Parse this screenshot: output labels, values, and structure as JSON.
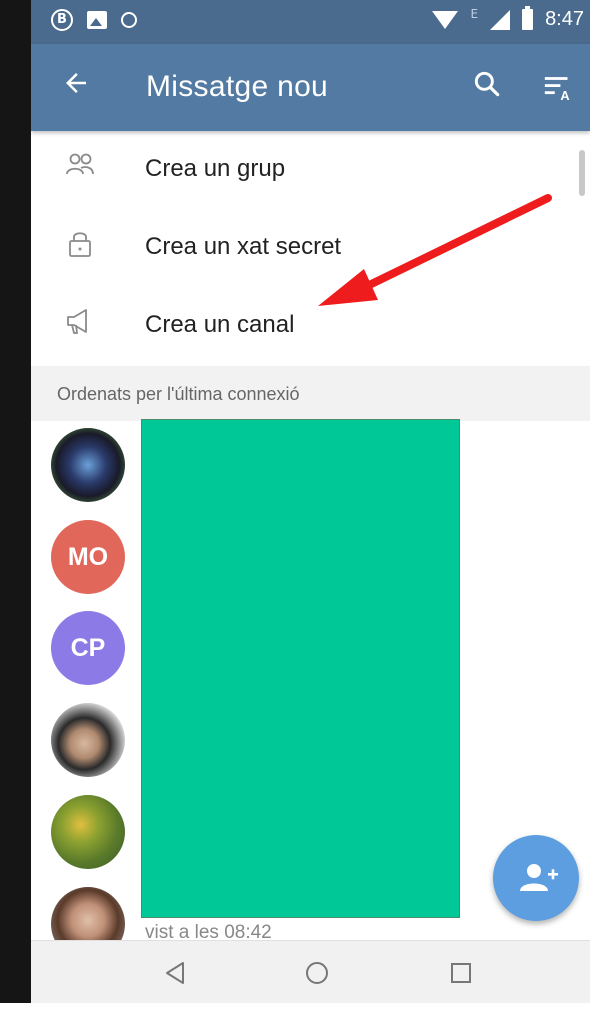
{
  "status_bar": {
    "time": "8:47",
    "network_letter": "E",
    "left_icons": [
      "b-circle-icon",
      "image-icon",
      "sync-icon"
    ],
    "right_icons": [
      "wifi-icon",
      "signal-icon",
      "battery-icon"
    ]
  },
  "toolbar": {
    "title": "Missatge nou",
    "back_icon": "arrow-left-icon",
    "search_icon": "search-icon",
    "sort_icon": "sort-alpha-icon"
  },
  "menu": {
    "items": [
      {
        "label": "Crea un grup",
        "icon": "group-icon"
      },
      {
        "label": "Crea un xat secret",
        "icon": "lock-icon"
      },
      {
        "label": "Crea un canal",
        "icon": "megaphone-icon"
      }
    ]
  },
  "contacts": {
    "section_header": "Ordenats per l'última connexió",
    "avatars": [
      {
        "type": "photo",
        "initials": ""
      },
      {
        "type": "initials",
        "initials": "MO",
        "color": "#e0675a"
      },
      {
        "type": "initials",
        "initials": "CP",
        "color": "#8c7ae6"
      },
      {
        "type": "photo",
        "initials": ""
      },
      {
        "type": "photo",
        "initials": ""
      },
      {
        "type": "photo",
        "initials": ""
      }
    ],
    "partial_status": "vist a les 08:42",
    "redacted_color": "#00c896"
  },
  "fab": {
    "icon": "add-contact-icon",
    "color": "#5c9ee0"
  },
  "nav_bar": {
    "icons": [
      "back-triangle-icon",
      "home-circle-icon",
      "recents-square-icon"
    ]
  },
  "annotation": {
    "type": "arrow",
    "color": "#ee1c1c",
    "points_to": "Crea un canal"
  },
  "colors": {
    "status_bar": "#4a6b8e",
    "toolbar": "#527aa3"
  }
}
